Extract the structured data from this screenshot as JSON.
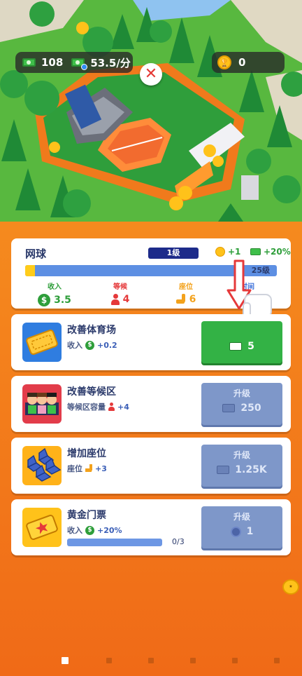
{
  "hud": {
    "cash": "108",
    "rate": "53.5/分",
    "trophies": "0"
  },
  "facility": {
    "name": "网球",
    "level": "1级",
    "bonus_trophy": "+1",
    "bonus_income": "+20%",
    "progress_fraction": 0.04,
    "progress_label": "25级",
    "stats": [
      {
        "label": "收入",
        "value": "3.5",
        "icon": "dollar-icon",
        "color": "#2e9e3a"
      },
      {
        "label": "等候",
        "value": "4",
        "icon": "person-icon",
        "color": "#e5393a"
      },
      {
        "label": "座位",
        "value": "6",
        "icon": "llama-icon",
        "color": "#f3a21c"
      },
      {
        "label": "时间",
        "value": "",
        "icon": "clock-icon",
        "color": "#3b6fd9"
      }
    ]
  },
  "upgrades": [
    {
      "title": "改善体育场",
      "desc_label": "收入",
      "desc_value": "+0.2",
      "button_label": "",
      "cost": "5",
      "state": "active"
    },
    {
      "title": "改善等候区",
      "desc_label": "等候区容量",
      "desc_value": "+4",
      "button_label": "升级",
      "cost": "250",
      "state": "disabled"
    },
    {
      "title": "增加座位",
      "desc_label": "座位",
      "desc_value": "+3",
      "button_label": "升级",
      "cost": "1.25K",
      "state": "disabled"
    },
    {
      "title": "黄金门票",
      "desc_label": "收入",
      "desc_value": "+20%",
      "button_label": "升级",
      "cost": "1",
      "state": "disabled",
      "progress_label": "0/3",
      "progress_fraction": 0
    }
  ],
  "pagination": {
    "count": 6,
    "active": 0
  },
  "colors": {
    "panel": "#f57d1c",
    "accent_green": "#33b245",
    "disabled_blue": "#7e97c9",
    "navy": "#1d2b8a"
  }
}
